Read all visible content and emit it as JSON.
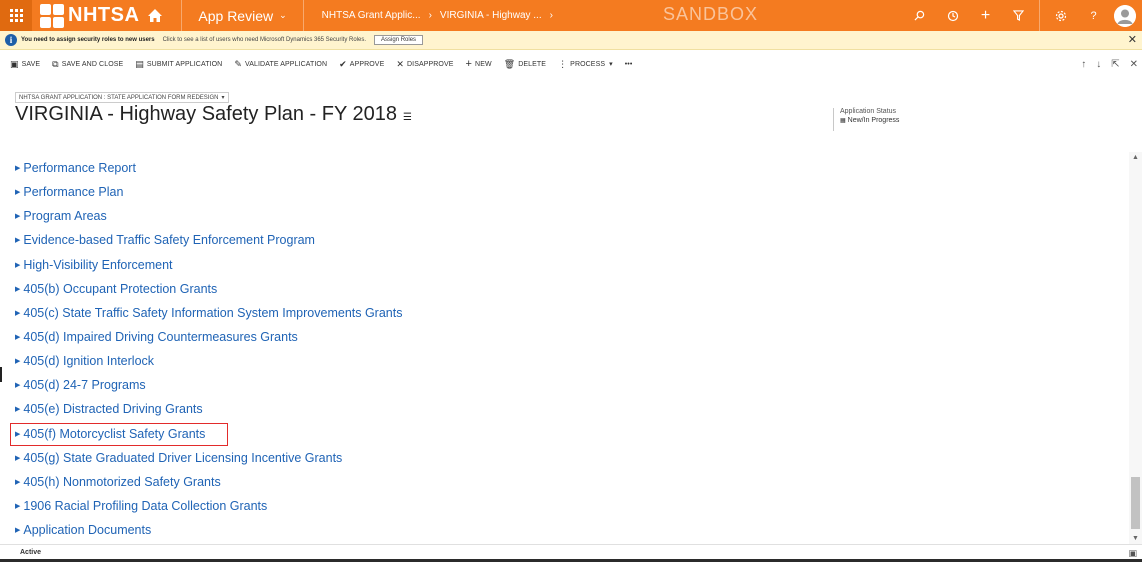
{
  "topbar": {
    "logo_text": "NHTSA",
    "app_name": "App Review",
    "breadcrumb_1": "NHTSA Grant Applic...",
    "breadcrumb_2": "VIRGINIA - Highway ...",
    "environment": "SANDBOX",
    "accent_color": "#f47b20"
  },
  "notification": {
    "strong_text": "You need to assign security roles to new users",
    "detail_text": "Click to see a list of users who need Microsoft Dynamics 365 Security Roles.",
    "button_label": "Assign Roles"
  },
  "commands": {
    "save": "SAVE",
    "save_and_close": "SAVE AND CLOSE",
    "submit": "SUBMIT APPLICATION",
    "validate": "VALIDATE APPLICATION",
    "approve": "APPROVE",
    "disapprove": "DISAPPROVE",
    "new": "NEW",
    "delete": "DELETE",
    "process": "PROCESS",
    "more": "•••"
  },
  "header": {
    "form_selector": "NHTSA GRANT APPLICATION : STATE APPLICATION FORM REDESIGN",
    "title": "VIRGINIA - Highway Safety Plan - FY 2018",
    "status_label": "Application Status",
    "status_value": "New/In Progress"
  },
  "sections": [
    "Performance Report",
    "Performance Plan",
    "Program Areas",
    "Evidence-based Traffic Safety Enforcement Program",
    "High-Visibility Enforcement",
    "405(b) Occupant Protection Grants",
    "405(c) State Traffic Safety Information System Improvements Grants",
    "405(d) Impaired Driving Countermeasures Grants",
    "405(d) Ignition Interlock",
    "405(d) 24-7 Programs",
    "405(e) Distracted Driving Grants",
    "405(f) Motorcyclist Safety Grants",
    "405(g) State Graduated Driver Licensing Incentive Grants",
    "405(h) Nonmotorized Safety Grants",
    "1906 Racial Profiling Data Collection Grants",
    "Application Documents"
  ],
  "footer": {
    "status": "Active"
  }
}
